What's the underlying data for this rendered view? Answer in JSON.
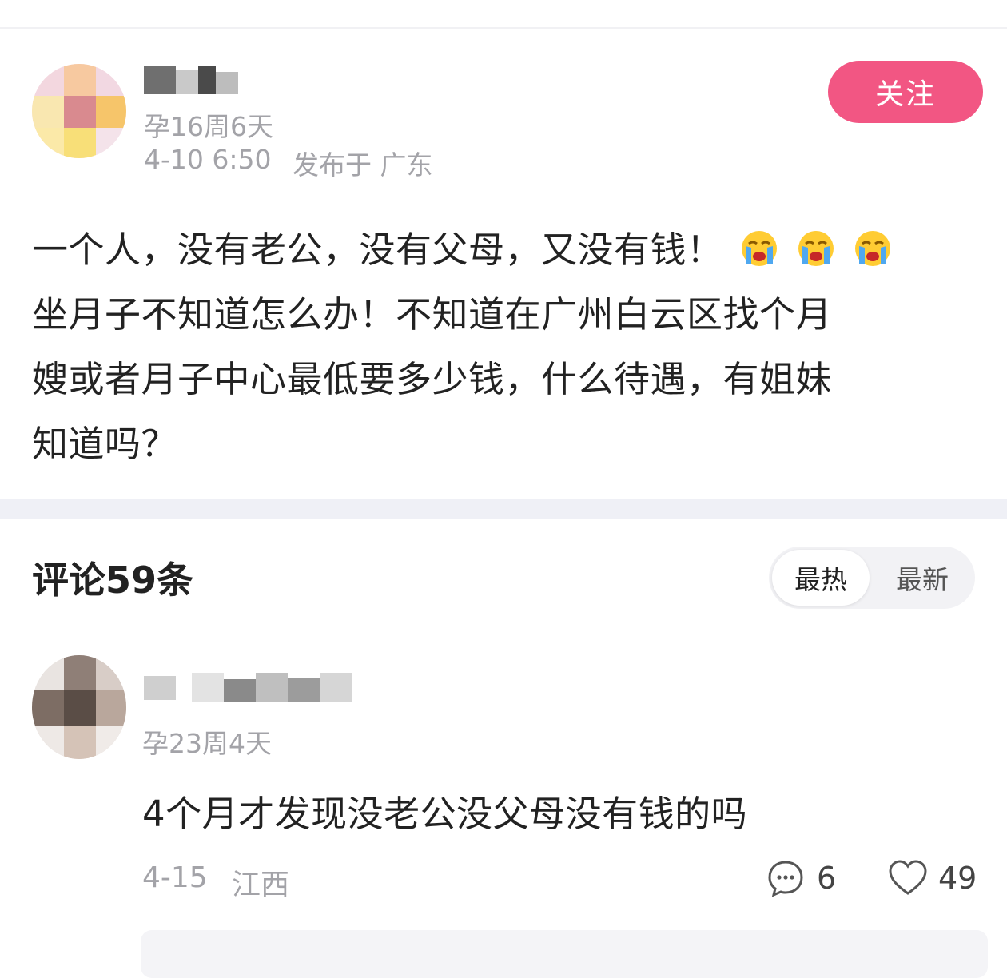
{
  "post": {
    "author_pregnancy": "孕16周6天",
    "date": "4-10 6:50",
    "location": "发布于 广东",
    "follow_label": "关注",
    "body": [
      {
        "text": "一个人，没有老公，没有父母，又没有钱！",
        "emoji": "crying-face",
        "emoji_count": 3
      },
      {
        "text": "坐月子不知道怎么办！不知道在广州白云区找个月"
      },
      {
        "text": "嫂或者月子中心最低要多少钱，什么待遇，有姐妹"
      },
      {
        "text": "知道吗？"
      }
    ]
  },
  "comments_section": {
    "title": "评论59条",
    "sort": {
      "hot": "最热",
      "new": "最新",
      "selected": "最热"
    }
  },
  "comment": {
    "author_pregnancy": "孕23周4天",
    "text": "4个月才发现没老公没父母没有钱的吗",
    "date": "4-15",
    "location": "江西",
    "reply_count": "6",
    "like_count": "49"
  },
  "colors": {
    "accent": "#f25683",
    "meta": "#a3a3a8",
    "divider": "#eff0f6"
  }
}
